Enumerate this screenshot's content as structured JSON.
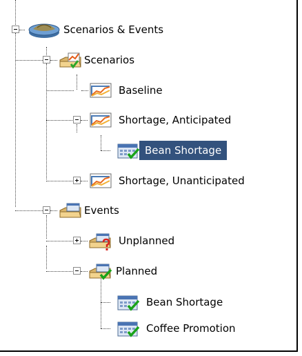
{
  "tree": {
    "root": {
      "label": "Scenarios & Events",
      "icon": "coffee-bean-pot-icon",
      "expanded": true
    },
    "scenarios": {
      "label": "Scenarios",
      "icon": "scenario-folder-check-icon",
      "expanded": true,
      "baseline": {
        "label": "Baseline",
        "icon": "line-chart-icon"
      },
      "shortage_anticipated": {
        "label": "Shortage, Anticipated",
        "icon": "line-chart-icon",
        "expanded": true,
        "bean_shortage": {
          "label": "Bean Shortage",
          "icon": "calendar-check-icon",
          "selected": true
        }
      },
      "shortage_unanticipated": {
        "label": "Shortage, Unanticipated",
        "icon": "line-chart-icon",
        "expanded": false
      }
    },
    "events": {
      "label": "Events",
      "icon": "calendar-folder-icon",
      "expanded": true,
      "unplanned": {
        "label": "Unplanned",
        "icon": "calendar-folder-question-icon",
        "expanded": false
      },
      "planned": {
        "label": "Planned",
        "icon": "calendar-folder-check-icon",
        "expanded": true,
        "bean_shortage": {
          "label": "Bean Shortage",
          "icon": "calendar-check-icon"
        },
        "coffee_promotion": {
          "label": "Coffee Promotion",
          "icon": "calendar-check-icon"
        }
      }
    }
  },
  "colors": {
    "selection": "#33527d",
    "selection_text": "#ffffff",
    "connector": "#444444"
  }
}
